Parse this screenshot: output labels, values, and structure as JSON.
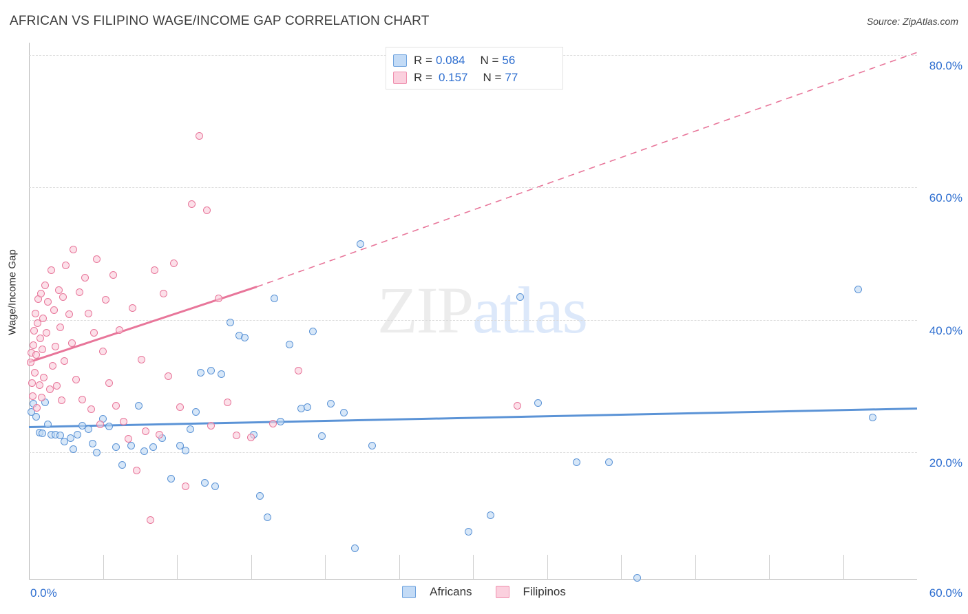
{
  "header": {
    "title": "AFRICAN VS FILIPINO WAGE/INCOME GAP CORRELATION CHART",
    "source": "Source: ZipAtlas.com"
  },
  "watermark": {
    "part1": "ZIP",
    "part2": "atlas"
  },
  "stats": {
    "rows": [
      {
        "series": "Africans",
        "r_label": "R =",
        "r_value": "0.084",
        "n_label": "N =",
        "n_value": "56",
        "color": "#c3dbf6"
      },
      {
        "series": "Filipinos",
        "r_label": "R =",
        "r_value": "0.157",
        "n_label": "N =",
        "n_value": "77",
        "color": "#fbd0de"
      }
    ]
  },
  "legend": {
    "items": [
      {
        "label": "Africans",
        "color": "#c3dbf6"
      },
      {
        "label": "Filipinos",
        "color": "#fbd0de"
      }
    ]
  },
  "chart_data": {
    "type": "scatter",
    "title": "AFRICAN VS FILIPINO WAGE/INCOME GAP CORRELATION CHART",
    "xlabel": "",
    "ylabel": "Wage/Income Gap",
    "xlim": [
      0,
      60
    ],
    "ylim": [
      0,
      88
    ],
    "grid": true,
    "x_tick_labels": [
      "0.0%",
      "60.0%"
    ],
    "y_tick_labels": [
      "20.0%",
      "40.0%",
      "60.0%",
      "80.0%"
    ],
    "y_ticks": [
      20,
      40,
      60,
      80
    ],
    "legend_position": "bottom-center",
    "series": [
      {
        "name": "Africans",
        "color": "#5b93d6",
        "fill": "#bed9f4",
        "r": 0.084,
        "n": 56,
        "trend": {
          "x0": 0,
          "y0": 23.8,
          "x1": 60,
          "y1": 26.6,
          "style": "solid"
        },
        "points": [
          [
            0.15,
            26.1
          ],
          [
            0.3,
            27.3
          ],
          [
            0.5,
            25.4
          ],
          [
            0.7,
            23.0
          ],
          [
            0.9,
            22.9
          ],
          [
            1.1,
            27.5
          ],
          [
            1.3,
            24.2
          ],
          [
            1.5,
            22.6
          ],
          [
            1.8,
            22.7
          ],
          [
            2.1,
            22.5
          ],
          [
            2.4,
            21.6
          ],
          [
            2.8,
            22.1
          ],
          [
            3.0,
            20.5
          ],
          [
            3.3,
            22.6
          ],
          [
            3.6,
            24.0
          ],
          [
            4.0,
            23.5
          ],
          [
            4.3,
            21.3
          ],
          [
            4.6,
            19.9
          ],
          [
            5.0,
            25.0
          ],
          [
            5.4,
            23.9
          ],
          [
            5.9,
            20.8
          ],
          [
            6.3,
            18.1
          ],
          [
            6.9,
            21.0
          ],
          [
            7.4,
            27.0
          ],
          [
            7.8,
            20.2
          ],
          [
            8.4,
            20.8
          ],
          [
            9.0,
            22.1
          ],
          [
            9.6,
            16.0
          ],
          [
            10.2,
            21.0
          ],
          [
            10.6,
            20.3
          ],
          [
            10.9,
            23.5
          ],
          [
            11.3,
            26.1
          ],
          [
            11.6,
            32.0
          ],
          [
            11.9,
            15.4
          ],
          [
            12.3,
            32.3
          ],
          [
            12.6,
            14.9
          ],
          [
            13.0,
            31.8
          ],
          [
            13.6,
            39.6
          ],
          [
            14.2,
            37.6
          ],
          [
            14.6,
            37.3
          ],
          [
            15.2,
            22.6
          ],
          [
            15.6,
            13.4
          ],
          [
            16.1,
            10.2
          ],
          [
            16.6,
            43.2
          ],
          [
            17.0,
            24.6
          ],
          [
            17.6,
            36.3
          ],
          [
            18.4,
            26.6
          ],
          [
            18.8,
            26.8
          ],
          [
            19.2,
            38.3
          ],
          [
            19.8,
            22.4
          ],
          [
            20.4,
            27.3
          ],
          [
            21.3,
            26.0
          ],
          [
            22.0,
            5.5
          ],
          [
            22.4,
            51.5
          ],
          [
            23.2,
            21.0
          ],
          [
            29.7,
            8.0
          ],
          [
            31.2,
            10.5
          ],
          [
            33.2,
            43.5
          ],
          [
            34.4,
            27.4
          ],
          [
            37.0,
            18.5
          ],
          [
            39.2,
            18.5
          ],
          [
            41.1,
            1.0
          ],
          [
            56.0,
            44.6
          ],
          [
            57.0,
            25.3
          ]
        ]
      },
      {
        "name": "Filipinos",
        "color": "#e8769a",
        "fill": "#facddb",
        "r": 0.157,
        "n": 77,
        "trend": {
          "x0": 0,
          "y0": 33.6,
          "x1": 15.4,
          "y1": 45.0,
          "style": "solid",
          "extension": {
            "x1": 60,
            "y1": 80.4,
            "style": "dashed"
          }
        },
        "points": [
          [
            0.1,
            33.6
          ],
          [
            0.15,
            35.0
          ],
          [
            0.2,
            30.5
          ],
          [
            0.25,
            28.5
          ],
          [
            0.3,
            36.2
          ],
          [
            0.35,
            38.4
          ],
          [
            0.4,
            32.0
          ],
          [
            0.45,
            41.0
          ],
          [
            0.5,
            34.7
          ],
          [
            0.55,
            26.7
          ],
          [
            0.6,
            39.5
          ],
          [
            0.65,
            43.1
          ],
          [
            0.7,
            30.1
          ],
          [
            0.75,
            37.2
          ],
          [
            0.8,
            44.0
          ],
          [
            0.85,
            28.3
          ],
          [
            0.9,
            35.5
          ],
          [
            0.95,
            40.2
          ],
          [
            1.0,
            31.3
          ],
          [
            1.1,
            45.2
          ],
          [
            1.2,
            38.0
          ],
          [
            1.3,
            42.7
          ],
          [
            1.4,
            29.5
          ],
          [
            1.5,
            47.5
          ],
          [
            1.6,
            33.0
          ],
          [
            1.7,
            41.5
          ],
          [
            1.8,
            36.0
          ],
          [
            1.9,
            30.0
          ],
          [
            2.0,
            44.5
          ],
          [
            2.1,
            38.9
          ],
          [
            2.2,
            27.8
          ],
          [
            2.3,
            43.5
          ],
          [
            2.4,
            33.8
          ],
          [
            2.5,
            48.2
          ],
          [
            2.7,
            40.8
          ],
          [
            2.9,
            36.5
          ],
          [
            3.0,
            50.6
          ],
          [
            3.2,
            31.0
          ],
          [
            3.4,
            44.2
          ],
          [
            3.6,
            28.0
          ],
          [
            3.8,
            46.4
          ],
          [
            4.0,
            41.0
          ],
          [
            4.2,
            26.5
          ],
          [
            4.4,
            38.0
          ],
          [
            4.6,
            49.2
          ],
          [
            4.8,
            24.2
          ],
          [
            5.0,
            35.2
          ],
          [
            5.2,
            43.0
          ],
          [
            5.4,
            30.5
          ],
          [
            5.7,
            46.8
          ],
          [
            5.9,
            27.0
          ],
          [
            6.1,
            38.5
          ],
          [
            6.4,
            24.6
          ],
          [
            6.7,
            22.0
          ],
          [
            7.0,
            41.8
          ],
          [
            7.3,
            17.2
          ],
          [
            7.6,
            34.0
          ],
          [
            7.9,
            23.2
          ],
          [
            8.2,
            9.8
          ],
          [
            8.5,
            47.5
          ],
          [
            8.8,
            22.6
          ],
          [
            9.1,
            44.0
          ],
          [
            9.4,
            31.5
          ],
          [
            9.8,
            48.5
          ],
          [
            10.2,
            26.8
          ],
          [
            10.6,
            14.9
          ],
          [
            11.0,
            57.5
          ],
          [
            11.5,
            67.8
          ],
          [
            12.0,
            56.6
          ],
          [
            12.3,
            24.0
          ],
          [
            12.8,
            43.2
          ],
          [
            13.4,
            27.5
          ],
          [
            14.0,
            22.5
          ],
          [
            15.0,
            22.2
          ],
          [
            16.5,
            24.3
          ],
          [
            18.2,
            32.3
          ],
          [
            33.0,
            27.0
          ]
        ]
      }
    ]
  }
}
